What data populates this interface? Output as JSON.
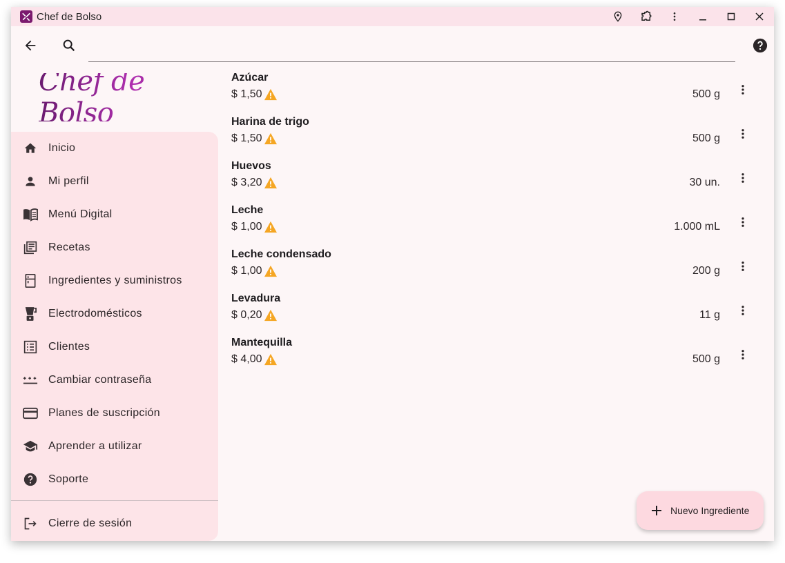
{
  "window": {
    "title": "Chef de Bolso"
  },
  "toolbar": {
    "search_placeholder": ""
  },
  "logo": {
    "text": "Chef de Bolso"
  },
  "nav": {
    "items": [
      {
        "label": "Inicio",
        "icon": "home-icon"
      },
      {
        "label": "Mi perfil",
        "icon": "person-icon"
      },
      {
        "label": "Menú Digital",
        "icon": "menu-book-icon"
      },
      {
        "label": "Recetas",
        "icon": "recipes-icon"
      },
      {
        "label": "Ingredientes y suministros",
        "icon": "fridge-icon"
      },
      {
        "label": "Electrodomésticos",
        "icon": "blender-icon"
      },
      {
        "label": "Clientes",
        "icon": "list-icon"
      },
      {
        "label": "Cambiar contraseña",
        "icon": "password-icon"
      },
      {
        "label": "Planes de suscripción",
        "icon": "credit-card-icon"
      },
      {
        "label": "Aprender a utilizar",
        "icon": "school-icon"
      },
      {
        "label": "Soporte",
        "icon": "help-icon"
      }
    ],
    "logout": {
      "label": "Cierre de sesión",
      "icon": "logout-icon"
    }
  },
  "ingredients": [
    {
      "name": "Azúcar",
      "price": "$ 1,50",
      "quantity": "500 g"
    },
    {
      "name": "Harina de trigo",
      "price": "$ 1,50",
      "quantity": "500 g"
    },
    {
      "name": "Huevos",
      "price": "$ 3,20",
      "quantity": "30 un."
    },
    {
      "name": "Leche",
      "price": "$ 1,00",
      "quantity": "1.000 mL"
    },
    {
      "name": "Leche condensado",
      "price": "$ 1,00",
      "quantity": "200 g"
    },
    {
      "name": "Levadura",
      "price": "$ 0,20",
      "quantity": "11 g"
    },
    {
      "name": "Mantequilla",
      "price": "$ 4,00",
      "quantity": "500 g"
    }
  ],
  "fab": {
    "label": "Nuevo Ingrediente"
  },
  "colors": {
    "titlebar": "#fbe3ea",
    "background": "#fdf6f7",
    "drawer": "#fde4e8",
    "fab": "#fdd9e0",
    "warning": "#f5a623",
    "logo": "#a0269c"
  }
}
